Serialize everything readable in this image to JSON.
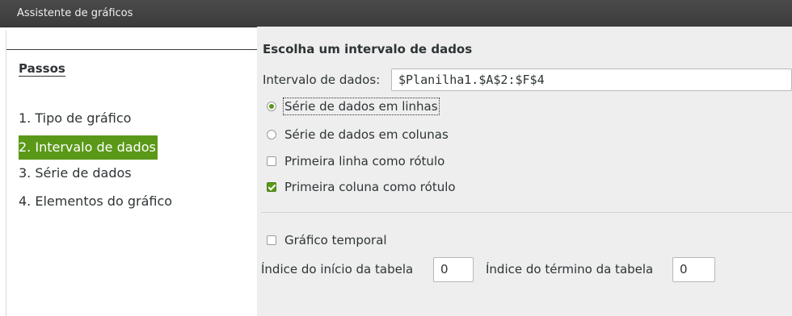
{
  "window": {
    "title": "Assistente de gráficos"
  },
  "steps": {
    "heading": "Passos",
    "items": [
      {
        "label": "1. Tipo de gráfico",
        "active": false
      },
      {
        "label": "2. Intervalo de dados",
        "active": true
      },
      {
        "label": "3. Série de dados",
        "active": false
      },
      {
        "label": "4. Elementos do gráfico",
        "active": false
      }
    ]
  },
  "panel": {
    "heading": "Escolha um intervalo de dados",
    "range_label": "Intervalo de dados:",
    "range_value": "$Planilha1.$A$2:$F$4",
    "radio_rows": "Série de dados em linhas",
    "radio_cols": "Série de dados em colunas",
    "first_row_label": "Primeira linha como rótulo",
    "first_col_label": "Primeira coluna como rótulo",
    "temporal_label": "Gráfico temporal",
    "start_index_label": "Índice do início da tabela",
    "start_index_value": "0",
    "end_index_label": "Índice do término da tabela",
    "end_index_value": "0"
  },
  "state": {
    "series_in": "rows",
    "first_row_checked": false,
    "first_col_checked": true,
    "temporal_checked": false
  },
  "colors": {
    "accent": "#5a9818",
    "titlebar": "#3c3c3c",
    "panel_bg": "#eeeeee"
  }
}
